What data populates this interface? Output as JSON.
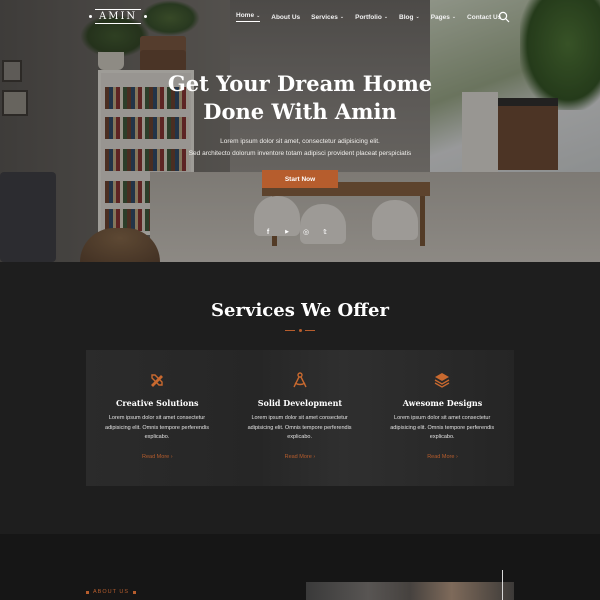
{
  "brand": {
    "logo_text": "AMIN"
  },
  "nav": {
    "items": [
      {
        "label": "Home",
        "has_dropdown": true,
        "active": true
      },
      {
        "label": "About Us",
        "has_dropdown": false
      },
      {
        "label": "Services",
        "has_dropdown": true
      },
      {
        "label": "Portfolio",
        "has_dropdown": true
      },
      {
        "label": "Blog",
        "has_dropdown": true
      },
      {
        "label": "Pages",
        "has_dropdown": true
      },
      {
        "label": "Contact Us",
        "has_dropdown": false
      }
    ],
    "search_icon": "search-icon",
    "dropdown_glyph": "⌄"
  },
  "hero": {
    "title_line1": "Get Your Dream Home",
    "title_line2": "Done With Amin",
    "subtitle_line1": "Lorem ipsum dolor sit amet, consectetur adipisicing elit.",
    "subtitle_line2": "Sed architecto dolorum inventore totam adipisci provident placeat perspiciatis",
    "cta_label": "Start Now",
    "socials": [
      {
        "icon": "facebook-icon",
        "glyph": "f"
      },
      {
        "icon": "youtube-icon",
        "glyph": "▶"
      },
      {
        "icon": "instagram-icon",
        "glyph": "◎"
      },
      {
        "icon": "twitter-icon",
        "glyph": "𝕥"
      }
    ]
  },
  "services": {
    "title": "Services We Offer",
    "cards": [
      {
        "icon": "tools-icon",
        "title": "Creative Solutions",
        "desc": "Lorem ipsum dolor sit amet consectetur adipisicing elit. Omnis tempore perferendis explicabo.",
        "link": "Read More"
      },
      {
        "icon": "compass-icon",
        "title": "Solid Development",
        "desc": "Lorem ipsum dolor sit amet consectetur adipisicing elit. Omnis tempore perferendis explicabo.",
        "link": "Read More"
      },
      {
        "icon": "layers-icon",
        "title": "Awesome Designs",
        "desc": "Lorem ipsum dolor sit amet consectetur adipisicing elit. Omnis tempore perferendis explicabo.",
        "link": "Read More"
      }
    ]
  },
  "about": {
    "label": "ABOUT US"
  },
  "colors": {
    "accent": "#b65d2d",
    "dark_bg": "#1e1e1e",
    "darker_bg": "#161616"
  }
}
